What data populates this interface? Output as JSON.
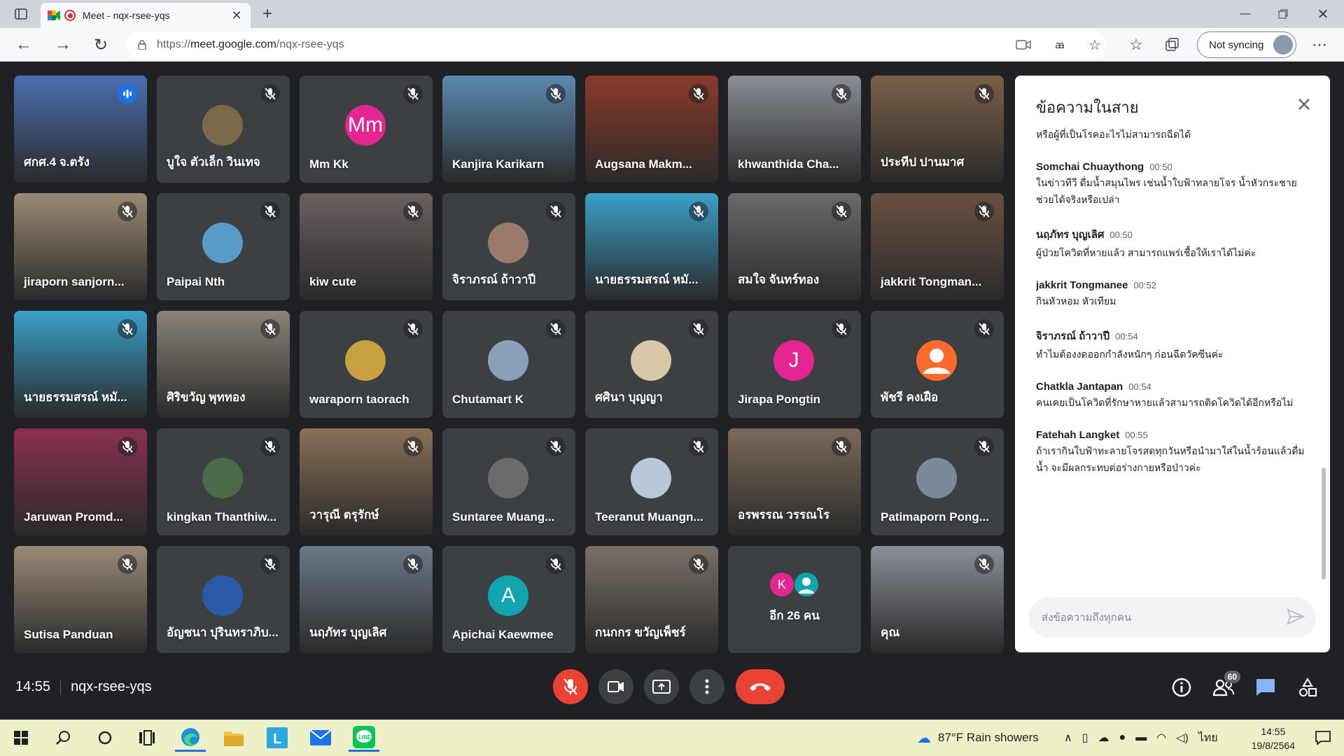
{
  "browser": {
    "tab_title": "Meet - nqx-rsee-yqs",
    "url_prefix": "https://",
    "url_host": "meet.google.com",
    "url_path": "/nqx-rsee-yqs",
    "sync_label": "Not syncing"
  },
  "participants": [
    {
      "name": "ศกศ.4 จ.ตรัง",
      "talking": true,
      "video": true,
      "bg": "#4a6fb0"
    },
    {
      "name": "บูใจ ตัวเล็ก วินเทจ",
      "avatar_color": "#7a6a4a"
    },
    {
      "name": "Mm Kk",
      "initials": "Mm",
      "avatar_color": "#e52592"
    },
    {
      "name": "Kanjira Karikarn",
      "video": true,
      "bg": "#5a8ab0"
    },
    {
      "name": "Augsana Makm...",
      "video": true,
      "bg": "#8b3a2a"
    },
    {
      "name": "khwanthida Cha...",
      "video": true,
      "bg": "#8a8f96"
    },
    {
      "name": "ประทีป ปานมาศ",
      "video": true,
      "bg": "#7a6048"
    },
    {
      "name": "jiraporn sanjorn...",
      "video": true,
      "bg": "#9a8a72"
    },
    {
      "name": "Paipai Nth",
      "avatar_color": "#5a9ac8"
    },
    {
      "name": "kiw cute",
      "video": true,
      "bg": "#6a6060"
    },
    {
      "name": "จิราภรณ์ ถ้าวาปี",
      "avatar_color": "#9a7a6a"
    },
    {
      "name": "นายธรรมสรณ์ หมั...",
      "video": true,
      "bg": "#3aa0c8"
    },
    {
      "name": "สมใจ จันทร์ทอง",
      "video": true,
      "bg": "#6a6a6a"
    },
    {
      "name": "jakkrit Tongman...",
      "video": true,
      "bg": "#6a5040"
    },
    {
      "name": "นายธรรมสรณ์ หมั...",
      "video": true,
      "bg": "#3aa0c8"
    },
    {
      "name": "ศิริขวัญ พุททอง",
      "video": true,
      "bg": "#8a8478"
    },
    {
      "name": "waraporn taorach",
      "avatar_color": "#c8a040"
    },
    {
      "name": "Chutamart K",
      "avatar_color": "#8aa0b8"
    },
    {
      "name": "ศศินา บุญญา",
      "avatar_color": "#d8c8a8"
    },
    {
      "name": "Jirapa Pongtin",
      "initials": "J",
      "avatar_color": "#e52592"
    },
    {
      "name": "พัชรี คงเฝือ",
      "avatar_color": "#fa6a2a",
      "person": true
    },
    {
      "name": "Jaruwan Promd...",
      "video": true,
      "bg": "#8a3050"
    },
    {
      "name": "kingkan Thanthiw...",
      "avatar_color": "#4a6a4a"
    },
    {
      "name": "วารุณี ตรุรักษ์",
      "video": true,
      "bg": "#8a7058"
    },
    {
      "name": "Suntaree Muang...",
      "avatar_color": "#6a6a6a"
    },
    {
      "name": "Teeranut Muangn...",
      "avatar_color": "#b8c8d8"
    },
    {
      "name": "อรพรรณ วรรณโร",
      "video": true,
      "bg": "#7a6a5a"
    },
    {
      "name": "Patimaporn Pong...",
      "avatar_color": "#7a8a9a"
    },
    {
      "name": "Sutisa Panduan",
      "video": true,
      "bg": "#9a8a78"
    },
    {
      "name": "อัญชนา ปุรินทราภิบ...",
      "avatar_color": "#2a5aa8"
    },
    {
      "name": "นฤภัทร บุญเลิศ",
      "video": true,
      "bg": "#6a7a88"
    },
    {
      "name": "Apichai Kaewmee",
      "initials": "A",
      "avatar_color": "#12a4af"
    },
    {
      "name": "กนกกร ขวัญเพ็ชร์",
      "video": true,
      "bg": "#7a7068"
    },
    {
      "name": "อีก 26 คน",
      "more": true
    },
    {
      "name": "คุณ",
      "video": true,
      "bg": "#8a9098"
    }
  ],
  "chat": {
    "title": "ข้อความในสาย",
    "input_placeholder": "ส่งข้อความถึงทุกคน",
    "messages": [
      {
        "sender": "",
        "time": "",
        "text": "หรือผู้ที่เป็นโรคอะไรไม่สามารถฉีดได้"
      },
      {
        "sender": "Somchai Chuaythong",
        "time": "00:50",
        "text": "ในข่าวทีวี ดื่มน้ำสมุนไพร เช่นน้ำใบฟ้าทลายโจร น้ำหัวกระชาย ช่วยได้จริงหรือเปล่า"
      },
      {
        "sender": "นฤภัทร บุญเลิศ",
        "time": "00:50",
        "text": "ผู้ป่วยโควิดที่หายแล้ว สามารถแพร่เชื้อให้เราได้ไม่ค่ะ"
      },
      {
        "sender": "jakkrit Tongmanee",
        "time": "00:52",
        "text": "กินหัวหอม หัวเทียม"
      },
      {
        "sender": "จิราภรณ์ ถ้าวาปี",
        "time": "00:54",
        "text": "ทำไมต้องงดออกกำลังหนักๆ ก่อนฉีดวัคซีนค่ะ"
      },
      {
        "sender": "Chatkla Jantapan",
        "time": "00:54",
        "text": "คนเคยเป็นโควิดที่รักษาหายแล้วสามารถติดโควิดได้อีกหรือไม่"
      },
      {
        "sender": "Fatehah Langket",
        "time": "00:55",
        "text": "ถ้าเรากินใบฟ้าทะลายโจรสดทุกวันหรือนำมาใส่ในน้ำร้อนแล้วดื่มน้ำ จะมีผลกระทบต่อร่างกายหรือป่าวค่ะ"
      }
    ]
  },
  "meeting": {
    "time": "14:55",
    "code": "nqx-rsee-yqs",
    "participant_count": "60",
    "more_initial": "K"
  },
  "taskbar": {
    "weather": "87°F  Rain showers",
    "lang": "ไทย",
    "time": "14:55",
    "date": "19/8/2564"
  }
}
